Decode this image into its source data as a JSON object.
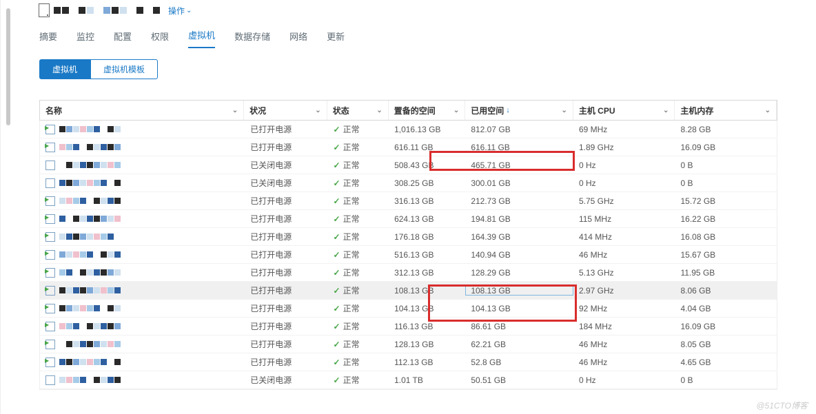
{
  "header": {
    "actions_label": "操作"
  },
  "tabs": [
    "摘要",
    "监控",
    "配置",
    "权限",
    "虚拟机",
    "数据存储",
    "网络",
    "更新"
  ],
  "active_tab": "虚拟机",
  "subtabs": {
    "a": "虚拟机",
    "b": "虚拟机模板"
  },
  "columns": {
    "name": "名称",
    "situation": "状况",
    "status": "状态",
    "provisioned": "置备的空间",
    "used": "已用空间",
    "cpu": "主机 CPU",
    "mem": "主机内存"
  },
  "status_normal": "正常",
  "rows": [
    {
      "sit": "已打开电源",
      "prov": "1,016.13 GB",
      "used": "812.07 GB",
      "cpu": "69 MHz",
      "mem": "8.28 GB",
      "on": true
    },
    {
      "sit": "已打开电源",
      "prov": "616.11 GB",
      "used": "616.11 GB",
      "cpu": "1.89 GHz",
      "mem": "16.09 GB",
      "on": true
    },
    {
      "sit": "已关闭电源",
      "prov": "508.43 GB",
      "used": "465.71 GB",
      "cpu": "0 Hz",
      "mem": "0 B",
      "on": false
    },
    {
      "sit": "已关闭电源",
      "prov": "308.25 GB",
      "used": "300.01 GB",
      "cpu": "0 Hz",
      "mem": "0 B",
      "on": false
    },
    {
      "sit": "已打开电源",
      "prov": "316.13 GB",
      "used": "212.73 GB",
      "cpu": "5.75 GHz",
      "mem": "15.72 GB",
      "on": true
    },
    {
      "sit": "已打开电源",
      "prov": "624.13 GB",
      "used": "194.81 GB",
      "cpu": "115 MHz",
      "mem": "16.22 GB",
      "on": true
    },
    {
      "sit": "已打开电源",
      "prov": "176.18 GB",
      "used": "164.39 GB",
      "cpu": "414 MHz",
      "mem": "16.08 GB",
      "on": true
    },
    {
      "sit": "已打开电源",
      "prov": "516.13 GB",
      "used": "140.94 GB",
      "cpu": "46 MHz",
      "mem": "15.67 GB",
      "on": true
    },
    {
      "sit": "已打开电源",
      "prov": "312.13 GB",
      "used": "128.29 GB",
      "cpu": "5.13 GHz",
      "mem": "11.95 GB",
      "on": true
    },
    {
      "sit": "已打开电源",
      "prov": "108.13 GB",
      "used": "108.13 GB",
      "cpu": "2.97 GHz",
      "mem": "8.06 GB",
      "on": true,
      "sel": true
    },
    {
      "sit": "已打开电源",
      "prov": "104.13 GB",
      "used": "104.13 GB",
      "cpu": "92 MHz",
      "mem": "4.04 GB",
      "on": true
    },
    {
      "sit": "已打开电源",
      "prov": "116.13 GB",
      "used": "86.61 GB",
      "cpu": "184 MHz",
      "mem": "16.09 GB",
      "on": true
    },
    {
      "sit": "已打开电源",
      "prov": "128.13 GB",
      "used": "62.21 GB",
      "cpu": "46 MHz",
      "mem": "8.05 GB",
      "on": true
    },
    {
      "sit": "已打开电源",
      "prov": "112.13 GB",
      "used": "52.8 GB",
      "cpu": "46 MHz",
      "mem": "4.65 GB",
      "on": true
    },
    {
      "sit": "已关闭电源",
      "prov": "1.01 TB",
      "used": "50.51 GB",
      "cpu": "0 Hz",
      "mem": "0 B",
      "on": false
    }
  ],
  "watermark": "@51CTO博客"
}
